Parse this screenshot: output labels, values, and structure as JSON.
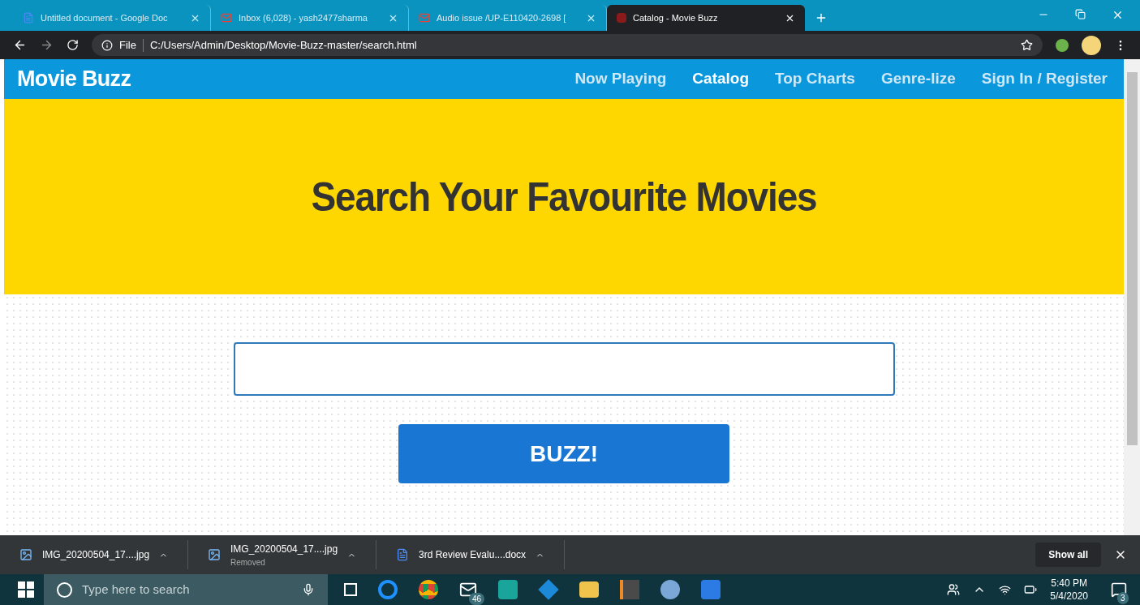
{
  "browser": {
    "tabs": [
      {
        "title": "Untitled document - Google Doc",
        "kind": "docs",
        "selected": false
      },
      {
        "title": "Inbox (6,028) - yash2477sharma",
        "kind": "mail",
        "selected": false
      },
      {
        "title": "Audio issue /UP-E110420-2698 [",
        "kind": "mail",
        "selected": false
      },
      {
        "title": "Catalog - Movie Buzz",
        "kind": "site",
        "selected": true
      }
    ],
    "address": {
      "scheme": "File",
      "url": "C:/Users/Admin/Desktop/Movie-Buzz-master/search.html"
    }
  },
  "navbar": {
    "brand": "Movie Buzz",
    "items": [
      {
        "label": "Now Playing",
        "selected": false
      },
      {
        "label": "Catalog",
        "selected": true
      },
      {
        "label": "Top Charts",
        "selected": false
      },
      {
        "label": "Genre-lize",
        "selected": false
      },
      {
        "label": "Sign In / Register",
        "selected": false
      }
    ]
  },
  "hero": {
    "title": "Search Your Favourite Movies"
  },
  "search": {
    "button": "BUZZ!"
  },
  "downloads": {
    "items": [
      {
        "name": "IMG_20200504_17....jpg",
        "kind": "image"
      },
      {
        "name": "IMG_20200504_17....jpg",
        "kind": "image",
        "status": "Removed"
      },
      {
        "name": "3rd Review Evalu....docx",
        "kind": "word"
      }
    ],
    "show_all": "Show all"
  },
  "taskbar": {
    "search_placeholder": "Type here to search",
    "mail_badge": "46",
    "time": "5:40 PM",
    "date": "5/4/2020",
    "notification_badge": "3"
  }
}
